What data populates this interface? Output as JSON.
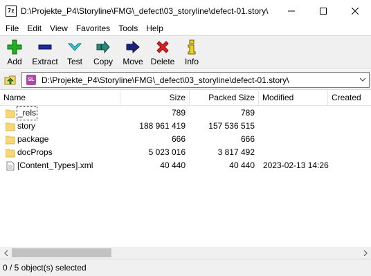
{
  "window": {
    "title": "D:\\Projekte_P4\\Storyline\\FMG\\_defect\\03_storyline\\defect-01.story\\",
    "app_icon_text": "7z"
  },
  "menu": [
    {
      "label": "File"
    },
    {
      "label": "Edit"
    },
    {
      "label": "View"
    },
    {
      "label": "Favorites"
    },
    {
      "label": "Tools"
    },
    {
      "label": "Help"
    }
  ],
  "toolbar": {
    "add": "Add",
    "extract": "Extract",
    "test": "Test",
    "copy": "Copy",
    "move": "Move",
    "delete": "Delete",
    "info": "Info"
  },
  "address": {
    "icon_text": "SL",
    "path": "D:\\Projekte_P4\\Storyline\\FMG\\_defect\\03_storyline\\defect-01.story\\"
  },
  "columns": {
    "name": "Name",
    "size": "Size",
    "packed": "Packed Size",
    "modified": "Modified",
    "created": "Created"
  },
  "rows": [
    {
      "name": "_rels",
      "type": "folder",
      "size": "789",
      "packed": "789",
      "modified": ""
    },
    {
      "name": "story",
      "type": "folder",
      "size": "188 961 419",
      "packed": "157 536 515",
      "modified": ""
    },
    {
      "name": "package",
      "type": "folder",
      "size": "666",
      "packed": "666",
      "modified": ""
    },
    {
      "name": "docProps",
      "type": "folder",
      "size": "5 023 016",
      "packed": "3 817 492",
      "modified": ""
    },
    {
      "name": "[Content_Types].xml",
      "type": "file",
      "size": "40 440",
      "packed": "40 440",
      "modified": "2023-02-13 14:26"
    }
  ],
  "status": {
    "text": "0 / 5 object(s) selected"
  },
  "colors": {
    "toolbar_bg": "#f0f0f0",
    "folder": "#f8d775",
    "add_green": "#22b022",
    "delete_red": "#e02020",
    "move_navy": "#1a237e"
  }
}
